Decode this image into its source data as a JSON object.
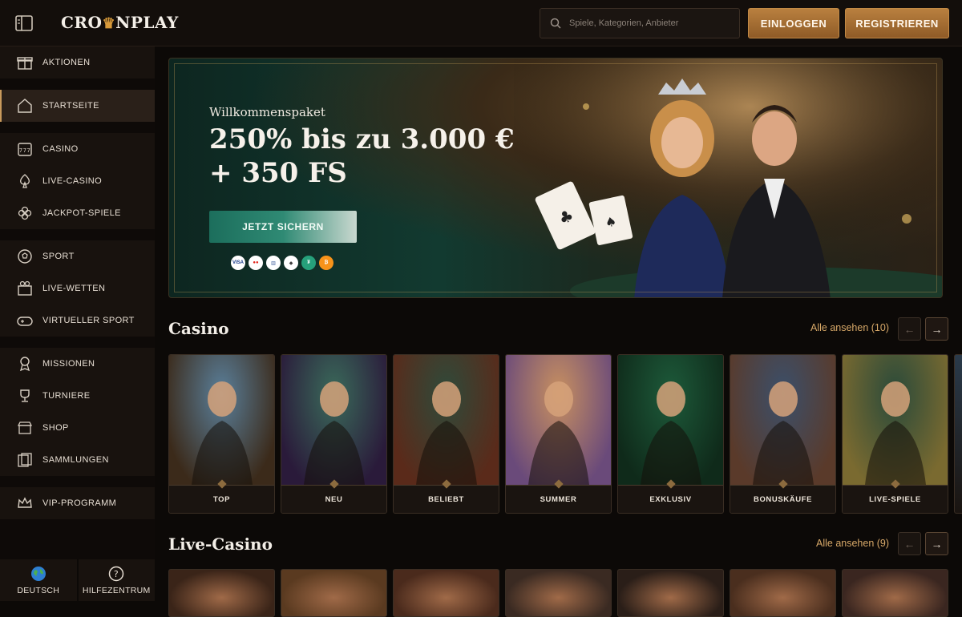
{
  "header": {
    "logo_left": "CRO",
    "logo_crown": "♛",
    "logo_right": "NPLAY",
    "search_placeholder": "Spiele, Kategorien, Anbieter",
    "login_label": "EINLOGGEN",
    "register_label": "REGISTRIEREN"
  },
  "sidebar": {
    "groups": [
      [
        {
          "label": "AKTIONEN",
          "icon": "gift-icon"
        }
      ],
      [
        {
          "label": "STARTSEITE",
          "icon": "home-icon",
          "active": true
        }
      ],
      [
        {
          "label": "CASINO",
          "icon": "slot-machine-icon"
        },
        {
          "label": "LIVE-CASINO",
          "icon": "spade-icon"
        },
        {
          "label": "JACKPOT-SPIELE",
          "icon": "clover-icon"
        }
      ],
      [
        {
          "label": "SPORT",
          "icon": "soccer-ball-icon"
        },
        {
          "label": "LIVE-WETTEN",
          "icon": "live-bet-icon"
        },
        {
          "label": "VIRTUELLER SPORT",
          "icon": "gamepad-icon"
        }
      ],
      [
        {
          "label": "MISSIONEN",
          "icon": "medal-icon"
        },
        {
          "label": "TURNIERE",
          "icon": "trophy-icon"
        },
        {
          "label": "SHOP",
          "icon": "shop-icon"
        },
        {
          "label": "SAMMLUNGEN",
          "icon": "collection-icon"
        }
      ],
      [
        {
          "label": "VIP-PROGRAMM",
          "icon": "crown-icon"
        }
      ]
    ],
    "footer": {
      "language_label": "DEUTSCH",
      "help_label": "HILFEZENTRUM"
    }
  },
  "hero": {
    "subtitle": "Willkommenspaket",
    "title": "250% bis zu 3.000 € + 350 FS",
    "cta_label": "JETZT SICHERN",
    "payments": [
      {
        "name": "visa-icon",
        "text": "VISA",
        "bg": "#ffffff",
        "fg": "#1a3c8c"
      },
      {
        "name": "mastercard-icon",
        "text": "●●",
        "bg": "#ffffff",
        "fg": "#e2231a"
      },
      {
        "name": "bank-icon",
        "text": "▥",
        "bg": "#ffffff",
        "fg": "#3a5a9a"
      },
      {
        "name": "ethereum-icon",
        "text": "◆",
        "bg": "#ffffff",
        "fg": "#3c3c3d"
      },
      {
        "name": "tether-icon",
        "text": "₮",
        "bg": "#26a17b",
        "fg": "#ffffff"
      },
      {
        "name": "bitcoin-icon",
        "text": "₿",
        "bg": "#f7931a",
        "fg": "#ffffff"
      }
    ]
  },
  "casino": {
    "title": "Casino",
    "see_all": "Alle ansehen (10)",
    "cards": [
      {
        "label": "TOP",
        "c1": "#5a7f9a",
        "c2": "#3b2a1a"
      },
      {
        "label": "NEU",
        "c1": "#3a6a5a",
        "c2": "#2a1a3a"
      },
      {
        "label": "BELIEBT",
        "c1": "#2f4a3a",
        "c2": "#5a2a1a"
      },
      {
        "label": "SUMMER",
        "c1": "#c89060",
        "c2": "#6a4a7a"
      },
      {
        "label": "EXKLUSIV",
        "c1": "#1d5a3a",
        "c2": "#0f2a1a"
      },
      {
        "label": "BONUSKÄUFE",
        "c1": "#3b4f6a",
        "c2": "#5a3a2a"
      },
      {
        "label": "LIVE-SPIELE",
        "c1": "#2a4a3a",
        "c2": "#7a6a30"
      }
    ]
  },
  "live_casino": {
    "title": "Live-Casino",
    "see_all": "Alle ansehen (9)"
  },
  "arrows": {
    "prev": "←",
    "next": "→"
  }
}
